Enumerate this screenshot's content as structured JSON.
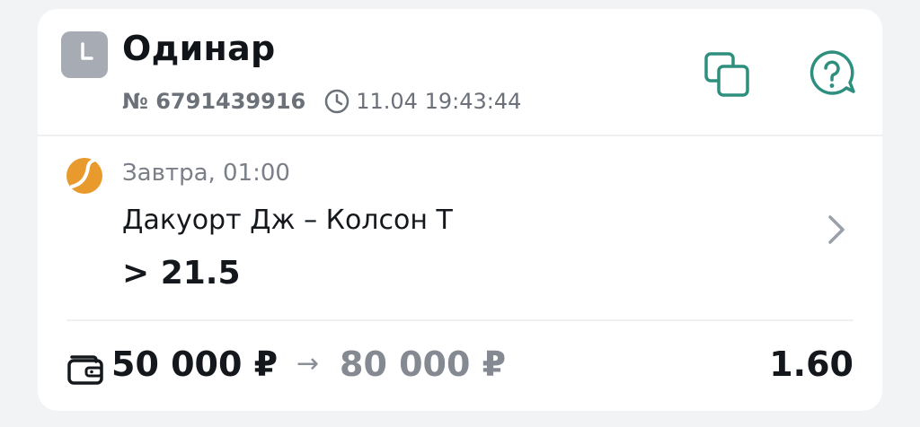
{
  "bet": {
    "type_label": "Одинар",
    "number": "№ 6791439916",
    "timestamp": "11.04 19:43:44"
  },
  "event": {
    "time": "Завтра, 01:00",
    "name": "Дакуорт Дж – Колсон Т",
    "outcome": "> 21.5",
    "sport_icon": "tennis-ball-icon"
  },
  "amounts": {
    "stake": "50 000 ₽",
    "arrow": "→",
    "payout": "80 000 ₽",
    "odds": "1.60"
  },
  "icons": {
    "header": "clock-icon",
    "copy": "copy-icon",
    "help": "help-chat-icon",
    "timestamp": "clock-outline-icon",
    "chevron": "chevron-right-icon",
    "wallet": "wallet-icon"
  },
  "colors": {
    "accent_teal": "#2f8f7e",
    "sport_orange": "#e89a2c",
    "badge_gray": "#a7abb3",
    "background": "#f2f3f5"
  }
}
